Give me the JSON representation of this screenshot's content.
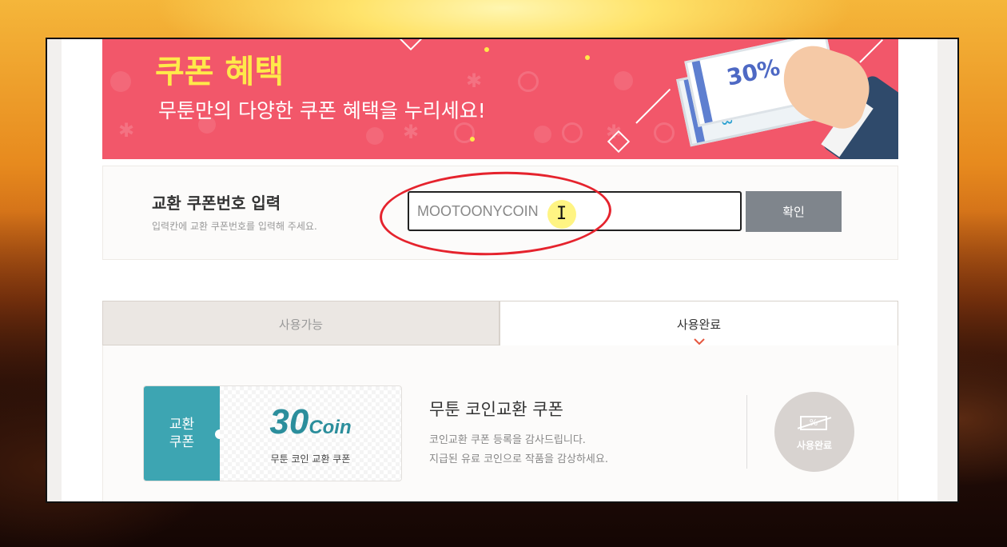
{
  "banner": {
    "title": "쿠폰 혜택",
    "subtitle": "무툰만의 다양한 쿠폰 혜택을 누리세요!",
    "ticket_discount": "30%"
  },
  "coupon_entry": {
    "title": "교환 쿠폰번호 입력",
    "hint": "입력칸에 교환 쿠폰번호를 입력해 주세요.",
    "input_value": "MOOTOONYCOIN",
    "confirm_label": "확인"
  },
  "tabs": [
    {
      "label": "사용가능",
      "active": false
    },
    {
      "label": "사용완료",
      "active": true
    }
  ],
  "coupon": {
    "type_label_line1": "교환",
    "type_label_line2": "쿠폰",
    "amount_number": "30",
    "amount_unit": "Coin",
    "card_caption": "무툰 코인 교환 쿠폰",
    "title": "무툰 코인교환 쿠폰",
    "desc_line1": "코인교환 쿠폰 등록을 감사드립니다.",
    "desc_line2": "지급된 유료 코인으로 작품을 감상하세요.",
    "status_icon_text": "%",
    "status_label": "사용완료"
  },
  "colors": {
    "banner_bg": "#f2576a",
    "banner_title": "#ffe94a",
    "coupon_teal": "#3da5b2",
    "confirm_button": "#7f858c",
    "annotation_red": "#e5232d",
    "tab_chevron": "#e5573f"
  },
  "icons": {
    "tab_indicator": "chevron-down-icon",
    "status_stamp": "coupon-used-icon",
    "cursor": "text-cursor-icon"
  }
}
